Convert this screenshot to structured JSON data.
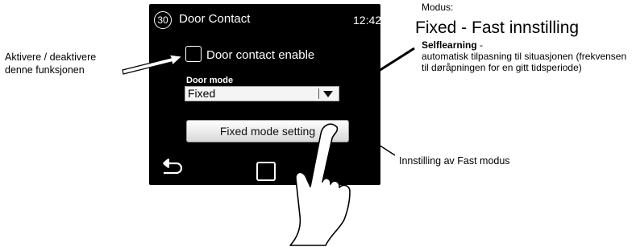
{
  "annotations": {
    "left": [
      "Aktivere / deaktivere",
      "denne funksjonen"
    ],
    "modus_label": "Modus:",
    "modus_fixed": "Fixed - Fast innstilling",
    "selflearning_title": "Selflearning",
    "selflearning_suffix": " -",
    "selflearning_desc": "automatisk tilpasning til situasjonen (frekvensen til døråpningen for en gitt tidsperiode)",
    "right": "Innstilling av Fast modus"
  },
  "screen": {
    "badge": "30",
    "title": "Door Contact",
    "time": "12:42",
    "checkbox_label": "Door contact enable",
    "checkbox_checked": false,
    "mode_label": "Door mode",
    "mode_value": "Fixed",
    "button_label": "Fixed mode setting"
  },
  "icons": [
    "back-arrow-icon",
    "home-square-icon",
    "dropdown-arrow-icon",
    "pointing-hand-icon"
  ]
}
